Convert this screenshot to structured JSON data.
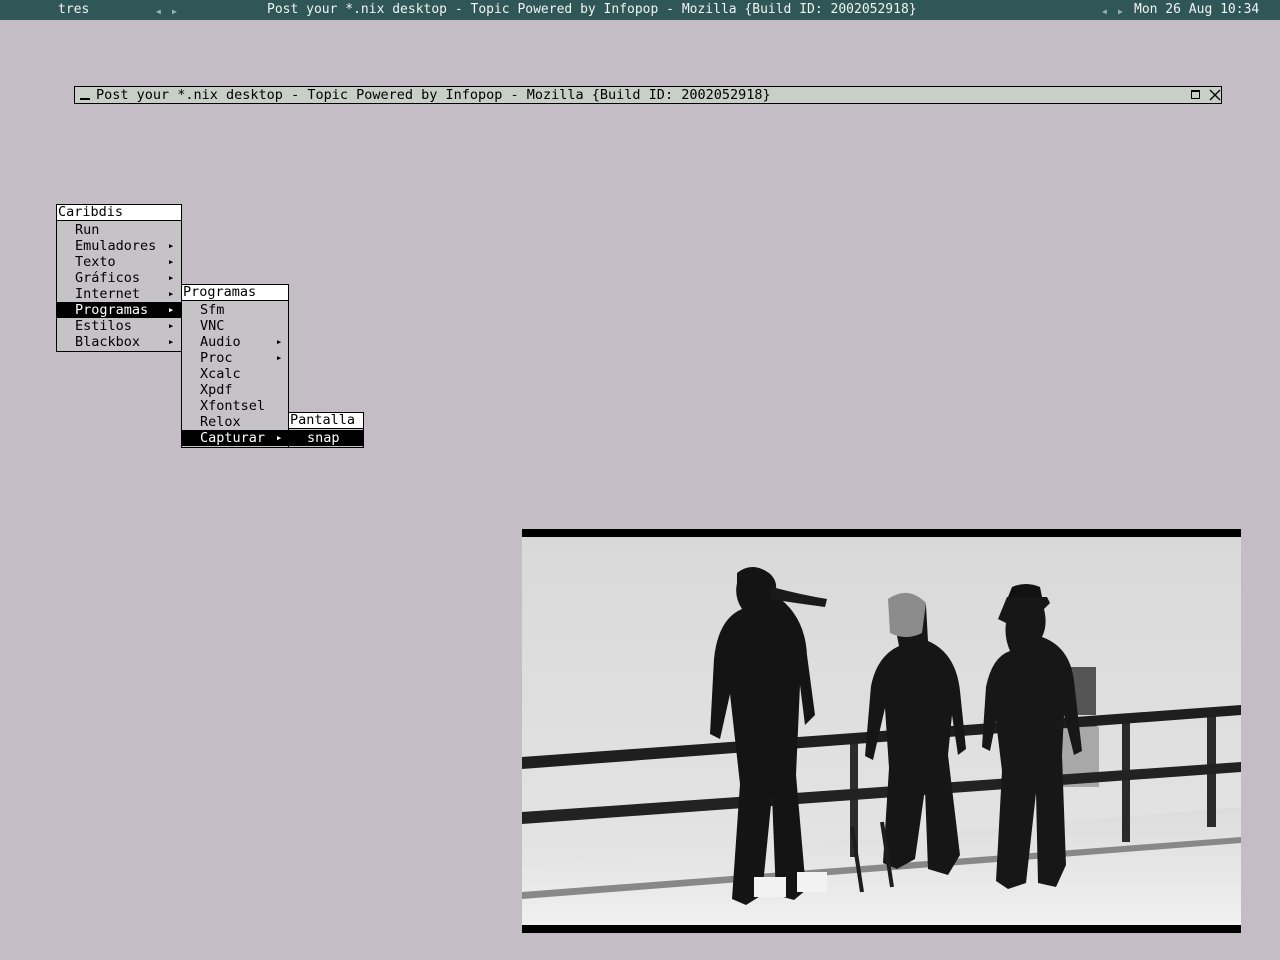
{
  "toolbar": {
    "workspace": "tres",
    "window_title": "Post your *.nix desktop - Topic Powered by Infopop - Mozilla {Build ID: 2002052918}",
    "clock": "Mon 26 Aug 10:34",
    "bg_color": "#2f5757"
  },
  "window": {
    "title": "Post your *.nix desktop - Topic Powered by Infopop - Mozilla {Build ID: 2002052918}"
  },
  "root_menu": {
    "title": "Caribdis",
    "items": [
      {
        "label": "Run",
        "submenu": false
      },
      {
        "label": "Emuladores",
        "submenu": true
      },
      {
        "label": "Texto",
        "submenu": true
      },
      {
        "label": "Gráficos",
        "submenu": true
      },
      {
        "label": "Internet",
        "submenu": true
      },
      {
        "label": "Programas",
        "submenu": true,
        "active": true
      },
      {
        "label": "Estilos",
        "submenu": true
      },
      {
        "label": "Blackbox",
        "submenu": true
      }
    ]
  },
  "programas_menu": {
    "title": "Programas",
    "items": [
      {
        "label": "Sfm",
        "submenu": false
      },
      {
        "label": "VNC",
        "submenu": false
      },
      {
        "label": "Audio",
        "submenu": true
      },
      {
        "label": "Proc",
        "submenu": true
      },
      {
        "label": "Xcalc",
        "submenu": false
      },
      {
        "label": "Xpdf",
        "submenu": false
      },
      {
        "label": "Xfontsel",
        "submenu": false
      },
      {
        "label": "Relox",
        "submenu": false
      },
      {
        "label": "Capturar",
        "submenu": true,
        "active": true
      }
    ]
  },
  "pantalla_menu": {
    "title": "Pantalla",
    "items": [
      {
        "label": "snap",
        "submenu": false,
        "active": true
      }
    ]
  },
  "desktop": {
    "background_color": "#c4bdc5",
    "photo": "black-and-white-photo-three-people-at-fence"
  }
}
